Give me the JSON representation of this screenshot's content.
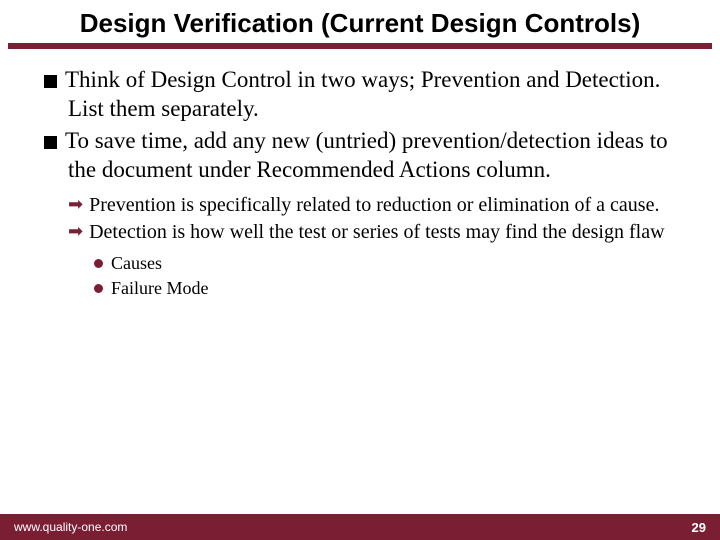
{
  "title": "Design Verification (Current Design Controls)",
  "bullets": {
    "lvl1": [
      "Think of Design Control in two ways; Prevention and Detection. List them separately.",
      "To save time, add any new (untried) prevention/detection ideas to the document under Recommended Actions column."
    ],
    "lvl2": [
      "Prevention is specifically related to reduction or elimination of a cause.",
      "Detection is how well the test or series of tests may find the design flaw"
    ],
    "lvl3": [
      "Causes",
      "Failure Mode"
    ]
  },
  "footer": {
    "url": "www.quality-one.com",
    "page": "29"
  },
  "colors": {
    "accent": "#7a1f33"
  }
}
